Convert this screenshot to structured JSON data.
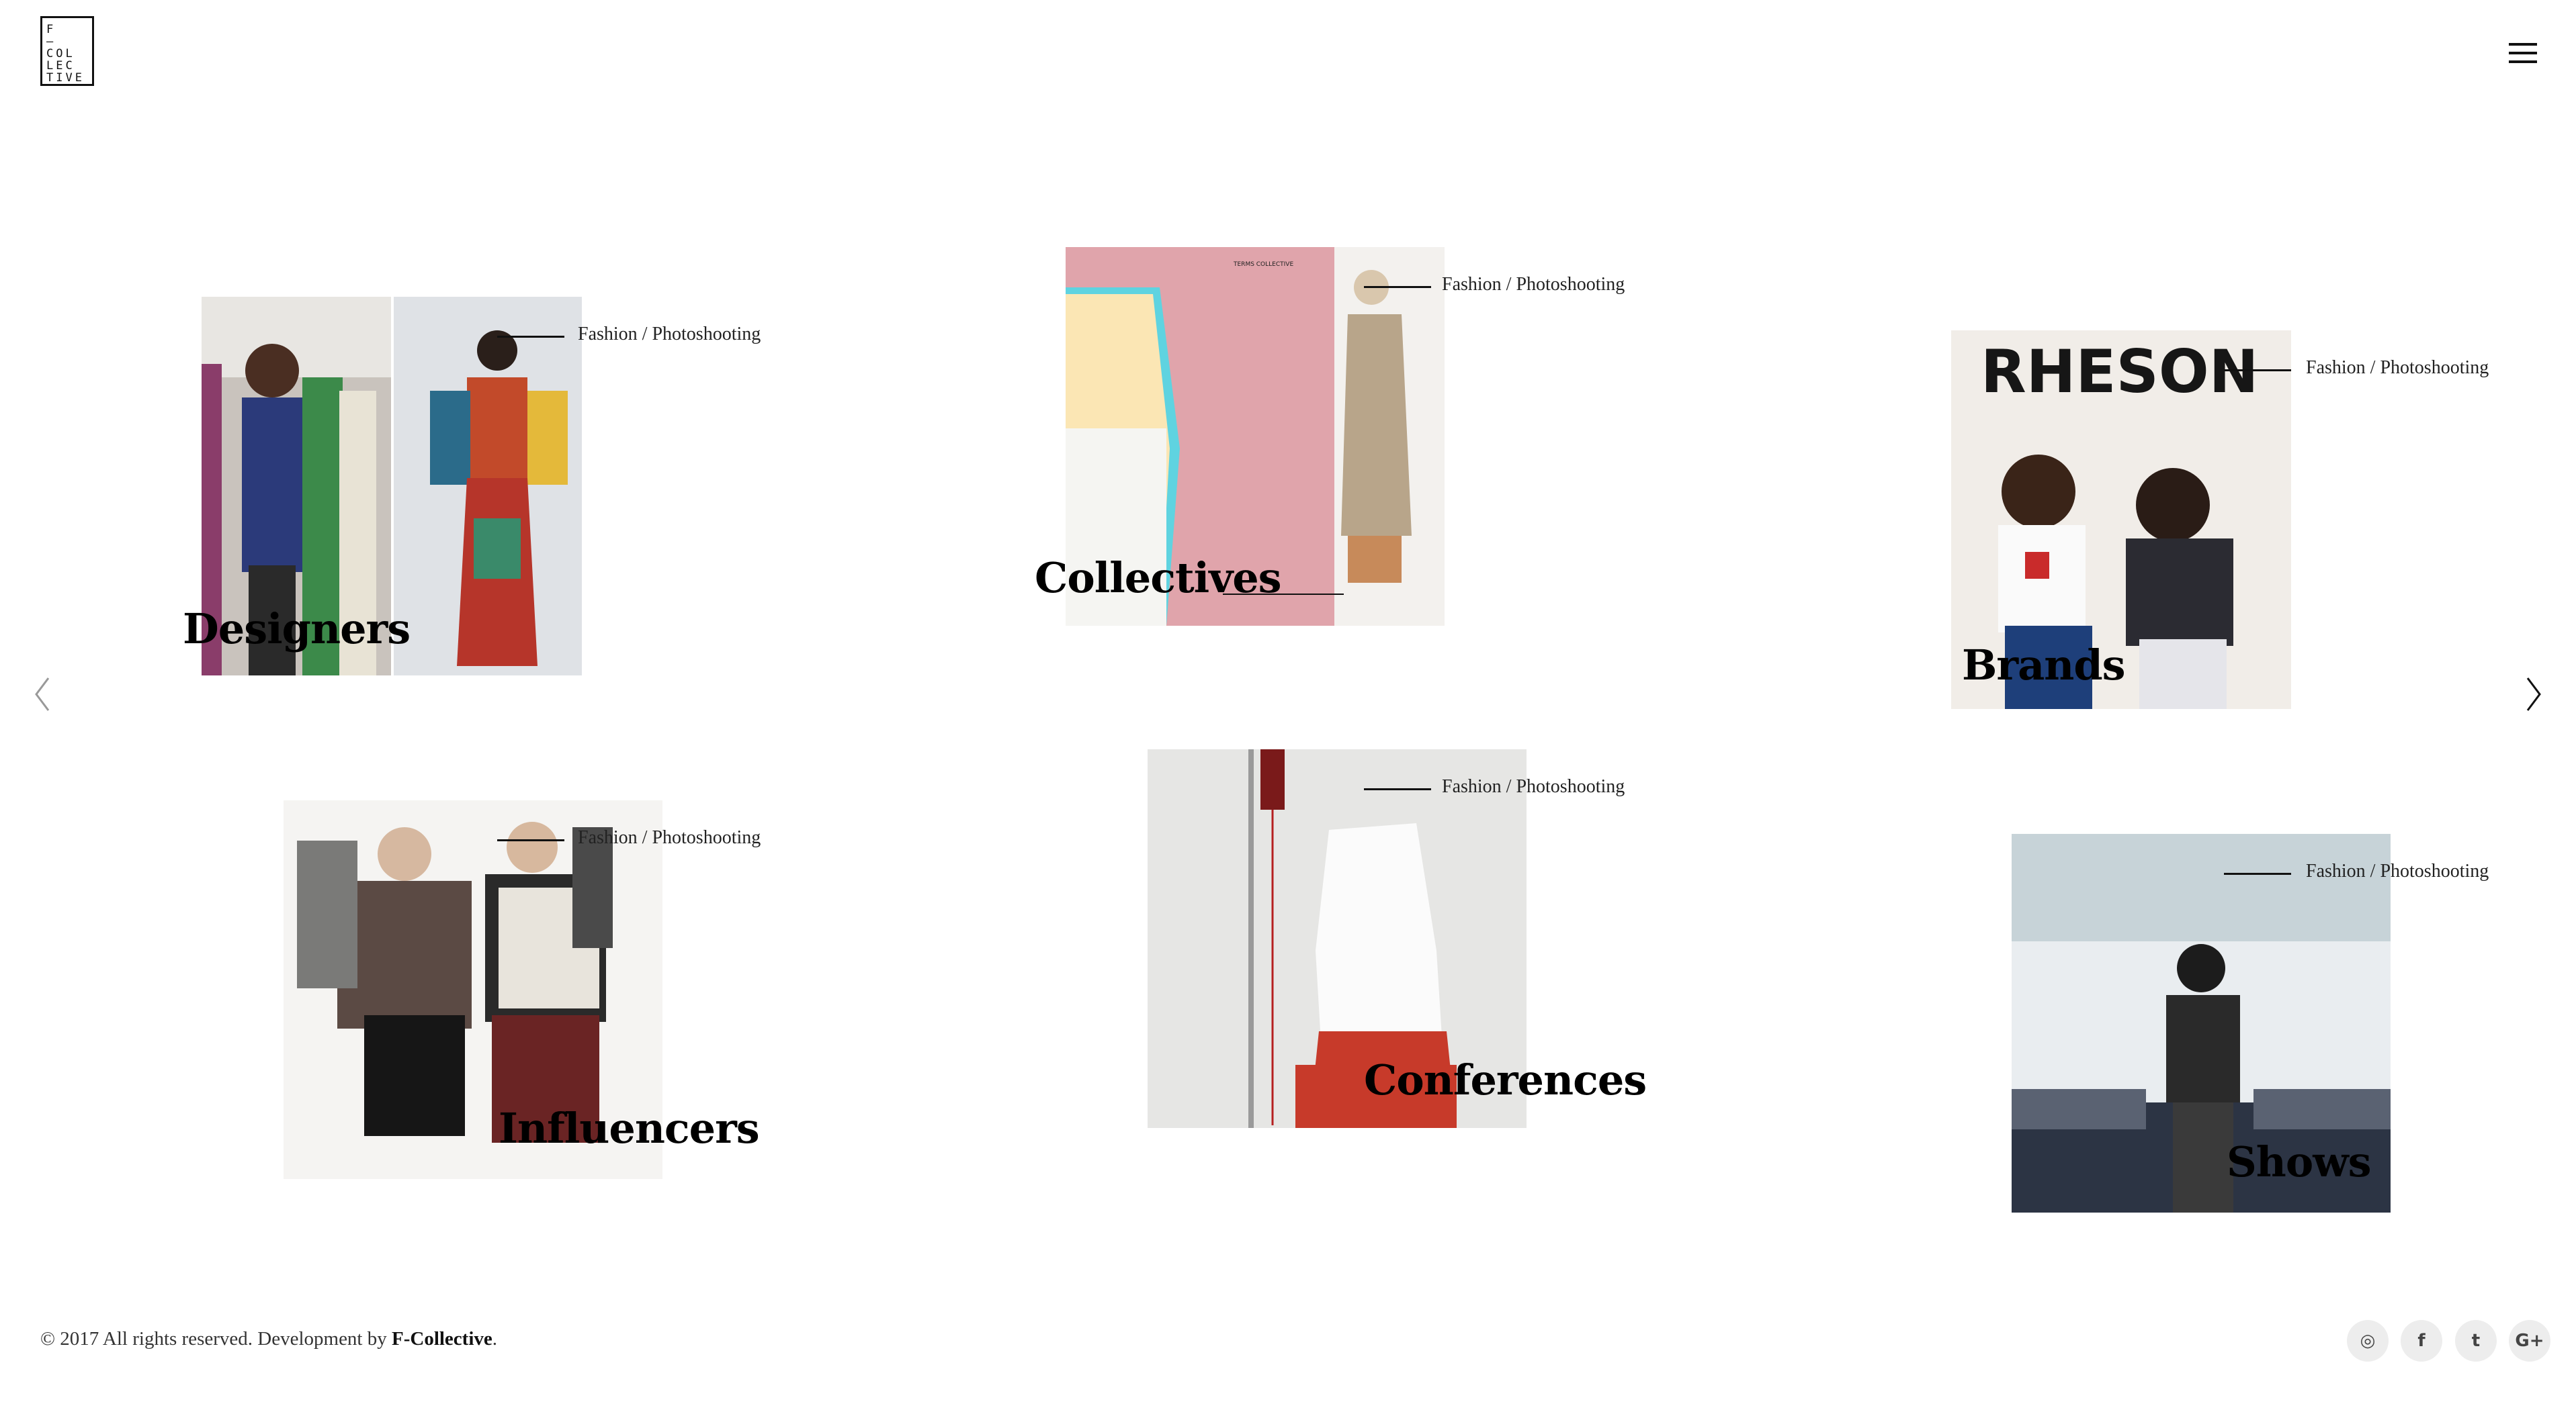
{
  "brand": {
    "logo_lines": [
      "F",
      "—",
      "COL",
      "LEC",
      "TIVE"
    ]
  },
  "cards": [
    {
      "title": "Designers",
      "tag": "Fashion / Photoshooting"
    },
    {
      "title": "Collectives",
      "tag": "Fashion / Photoshooting"
    },
    {
      "title": "Brands",
      "tag": "Fashion / Photoshooting",
      "photo_text": "RHESON"
    },
    {
      "title": "Influencers",
      "tag": "Fashion / Photoshooting"
    },
    {
      "title": "Conferences",
      "tag": "Fashion / Photoshooting"
    },
    {
      "title": "Shows",
      "tag": "Fashion / Photoshooting"
    }
  ],
  "footer": {
    "copyright_prefix": "© 2017 All rights reserved. Development by ",
    "company": "F-Collective",
    "suffix": "."
  },
  "social": [
    {
      "icon": "instagram-icon",
      "glyph": "◎"
    },
    {
      "icon": "facebook-icon",
      "glyph": "f"
    },
    {
      "icon": "twitter-icon",
      "glyph": "t"
    },
    {
      "icon": "google-plus-icon",
      "glyph": "G+"
    }
  ]
}
